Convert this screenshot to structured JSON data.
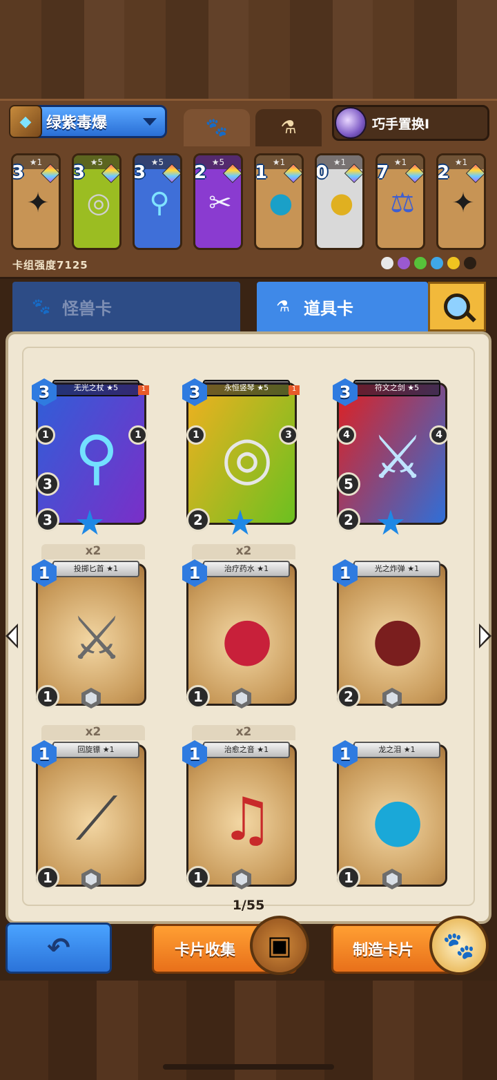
{
  "deck": {
    "name": "绿紫毒爆",
    "hero_name": "巧手置换I",
    "power_label": "卡组强度7125",
    "cards": [
      {
        "cost": "3",
        "stars": "★1",
        "frame": "#c79455",
        "art": "✦",
        "art_color": "#1c1c1c"
      },
      {
        "cost": "3",
        "stars": "★5",
        "frame": "#9bbd22",
        "art": "◎",
        "art_color": "#d0d0d0"
      },
      {
        "cost": "3",
        "stars": "★5",
        "frame": "#3f6fd8",
        "art": "⚲",
        "art_color": "#7fe3ff"
      },
      {
        "cost": "2",
        "stars": "★5",
        "frame": "#8a3bd0",
        "art": "✂",
        "art_color": "#f0f0ff"
      },
      {
        "cost": "1",
        "stars": "★1",
        "frame": "#c79455",
        "art": "●",
        "art_color": "#1aa0c8"
      },
      {
        "cost": "0",
        "stars": "★1",
        "frame": "#d9d9d9",
        "art": "●",
        "art_color": "#e0b020"
      },
      {
        "cost": "7",
        "stars": "★1",
        "frame": "#c79455",
        "art": "⚖",
        "art_color": "#3f5fd0"
      },
      {
        "cost": "2",
        "stars": "★1",
        "frame": "#c79455",
        "art": "✦",
        "art_color": "#1c1c1c"
      }
    ],
    "element_colors": [
      "#e8e8e8",
      "#9b59d0",
      "#57c23a",
      "#3fa7e8",
      "#f0c420",
      "#2a1e14"
    ]
  },
  "tabs": {
    "monster": "怪兽卡",
    "item": "道具卡"
  },
  "cards": [
    {
      "name": "无光之杖 ★5",
      "cost": "3",
      "kind": "epic",
      "bg": "linear-gradient(120deg,#2f5fd8,#7a2fc8)",
      "art": "⚲",
      "art_color": "#73e0ff",
      "stat1": "3",
      "stat2": "3",
      "extra1": "1",
      "extra2": "1",
      "flag": "1"
    },
    {
      "name": "永恒竖琴 ★5",
      "cost": "3",
      "kind": "epic",
      "bg": "linear-gradient(120deg,#f0b020,#6cc020)",
      "art": "◎",
      "art_color": "#e6e6e6",
      "stat1": "2",
      "stat2": "",
      "extra1": "1",
      "extra2": "3",
      "flag": "1"
    },
    {
      "name": "符文之剑 ★5",
      "cost": "3",
      "kind": "epic",
      "bg": "linear-gradient(120deg,#e02020,#2f6fd8)",
      "art": "⚔",
      "art_color": "#bfe4ff",
      "stat1": "2",
      "stat2": "5",
      "extra1": "4",
      "extra2": "4",
      "flag": ""
    },
    {
      "name": "投掷匕首 ★1",
      "cost": "1",
      "kind": "normal",
      "dup": "x2",
      "art": "⚔",
      "art_color": "#6a6a6a",
      "stat1": "1"
    },
    {
      "name": "治疗药水 ★1",
      "cost": "1",
      "kind": "normal",
      "dup": "x2",
      "art": "●",
      "art_color": "#c8203a",
      "stat1": "1"
    },
    {
      "name": "光之炸弹 ★1",
      "cost": "1",
      "kind": "normal",
      "dup": "",
      "art": "●",
      "art_color": "#7a1e1e",
      "stat1": "2"
    },
    {
      "name": "回旋镖 ★1",
      "cost": "1",
      "kind": "normal",
      "dup": "x2",
      "art": "⟋",
      "art_color": "#4a4a4a",
      "stat1": "1"
    },
    {
      "name": "治愈之音 ★1",
      "cost": "1",
      "kind": "normal",
      "dup": "x2",
      "art": "♫",
      "art_color": "#c82a2a",
      "stat1": "1"
    },
    {
      "name": "龙之泪 ★1",
      "cost": "1",
      "kind": "normal",
      "dup": "",
      "art": "●",
      "art_color": "#1aa8d8",
      "stat1": "1"
    }
  ],
  "pagination": "1/55",
  "buttons": {
    "collect": "卡片收集",
    "craft": "制造卡片"
  }
}
